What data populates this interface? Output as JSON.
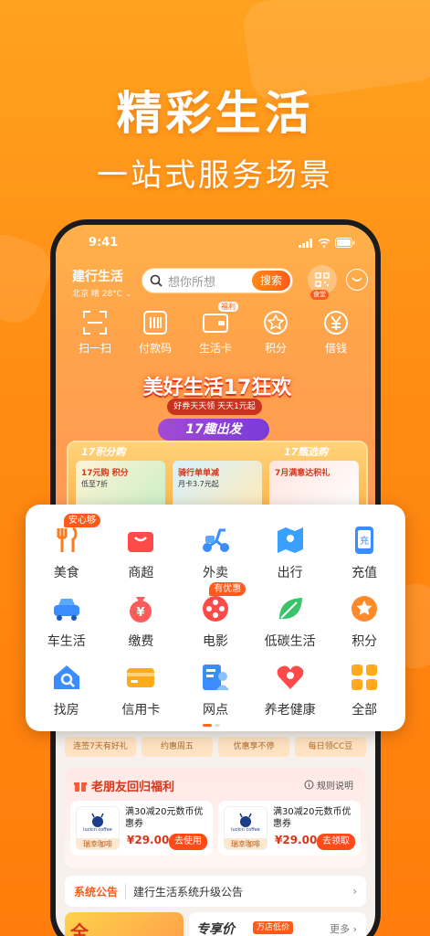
{
  "hero": {
    "title": "精彩生活",
    "subtitle": "一站式服务场景"
  },
  "status": {
    "time": "9:41"
  },
  "header": {
    "brand": "建行生活",
    "location": "北京 晴 28°C",
    "search_placeholder": "想你所想",
    "search_button": "搜索",
    "qr_tag": "食堂"
  },
  "quick": [
    {
      "label": "扫一扫",
      "icon": "scan-icon"
    },
    {
      "label": "付款码",
      "icon": "barcode-icon"
    },
    {
      "label": "生活卡",
      "icon": "card-icon",
      "tag": "福利"
    },
    {
      "label": "积分",
      "icon": "star-icon"
    },
    {
      "label": "借钱",
      "icon": "yen-icon"
    }
  ],
  "promo": {
    "title": "美好生活17狂欢",
    "subtitle": "好券天天领  天天1元起",
    "pill": "17趣出发",
    "cards": [
      {
        "title": "17积分购",
        "t1": "17元购 积分",
        "t2": "低至7折"
      },
      {
        "title": "",
        "t1": "骑行单单减",
        "t2": "月卡3.7元起"
      },
      {
        "title": "17甄选购",
        "t1": "7月满意达积礼",
        "t2": ""
      }
    ]
  },
  "services": [
    {
      "label": "美食",
      "icon": "fork-icon",
      "badge": "安心够",
      "color": "#ff7a1a"
    },
    {
      "label": "商超",
      "icon": "shop-icon",
      "color": "#ff4a4a"
    },
    {
      "label": "外卖",
      "icon": "scooter-icon",
      "color": "#3a8cff"
    },
    {
      "label": "出行",
      "icon": "map-icon",
      "color": "#3aa0ff"
    },
    {
      "label": "充值",
      "icon": "phone-charge-icon",
      "color": "#3a8cff"
    },
    {
      "label": "车生活",
      "icon": "car-icon",
      "color": "#3a8cff"
    },
    {
      "label": "缴费",
      "icon": "money-bag-icon",
      "color": "#ff5a5a"
    },
    {
      "label": "电影",
      "icon": "film-icon",
      "badge": "有优惠",
      "color": "#ff4a4a"
    },
    {
      "label": "低碳生活",
      "icon": "leaf-icon",
      "color": "#3ac46a"
    },
    {
      "label": "积分",
      "icon": "points-icon",
      "color": "#ff8a2a"
    },
    {
      "label": "找房",
      "icon": "house-icon",
      "color": "#3a8cff"
    },
    {
      "label": "信用卡",
      "icon": "credit-card-icon",
      "color": "#ffaa1a"
    },
    {
      "label": "网点",
      "icon": "branch-icon",
      "color": "#3a8cff"
    },
    {
      "label": "养老健康",
      "icon": "heart-icon",
      "color": "#ff4a4a"
    },
    {
      "label": "全部",
      "icon": "grid-icon",
      "color": "#ffaa1a"
    }
  ],
  "strip": [
    "连签7天有好礼",
    "约惠周五",
    "优惠享不停",
    "每日领CC豆"
  ],
  "friend": {
    "title": "老朋友回归福利",
    "rule": "规则说明",
    "coupons": [
      {
        "desc": "满30减20元数币优惠券",
        "price": "¥29.00",
        "button": "去使用",
        "brand": "luckin coffee",
        "brand_cn": "瑞幸咖啡"
      },
      {
        "desc": "满30减20元数币优惠券",
        "price": "¥29.00",
        "button": "去领取",
        "brand": "luckin coffee",
        "brand_cn": "瑞幸咖啡"
      }
    ]
  },
  "notice": {
    "key": "系统公告",
    "value": "建行生活系统升级公告"
  },
  "bottom": {
    "left": "全",
    "title": "专享价",
    "tag": "万店低价",
    "more": "更多"
  }
}
